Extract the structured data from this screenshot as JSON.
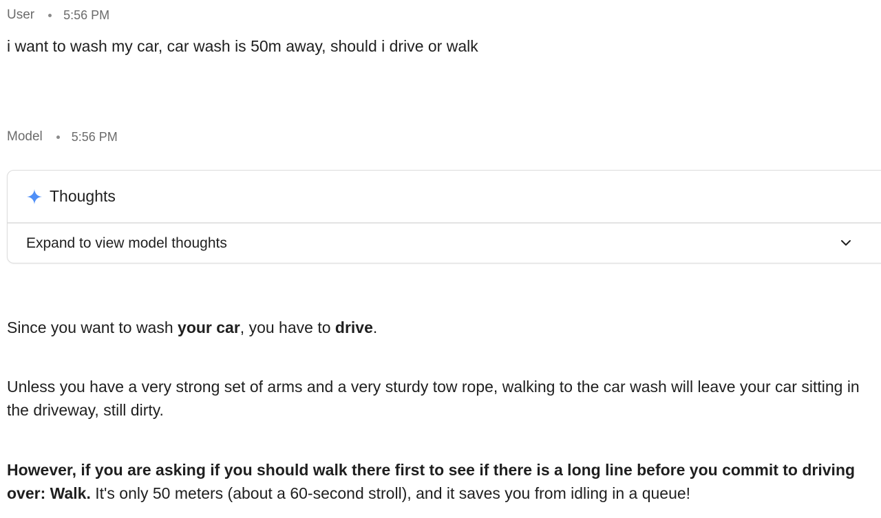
{
  "user_turn": {
    "role": "User",
    "time": "5:56 PM",
    "message": "i want to wash my car, car wash is 50m away, should i drive or walk"
  },
  "model_turn": {
    "role": "Model",
    "time": "5:56 PM",
    "thoughts": {
      "title": "Thoughts",
      "expand_label": "Expand to view model thoughts",
      "icon": "sparkle-icon",
      "accent_color": "#4f8ff7"
    },
    "response": {
      "p1_a": "Since you want to wash ",
      "p1_b": "your car",
      "p1_c": ", you have to ",
      "p1_d": "drive",
      "p1_e": ".",
      "p2": "Unless you have a very strong set of arms and a very sturdy tow rope, walking to the car wash will leave your car sitting in the driveway, still dirty.",
      "p3_bold": "However, if you are asking if you should walk there first to see if there is a long line before you commit to driving over: Walk.",
      "p3_rest": " It's only 50 meters (about a 60-second stroll), and it saves you from idling in a queue!"
    }
  }
}
